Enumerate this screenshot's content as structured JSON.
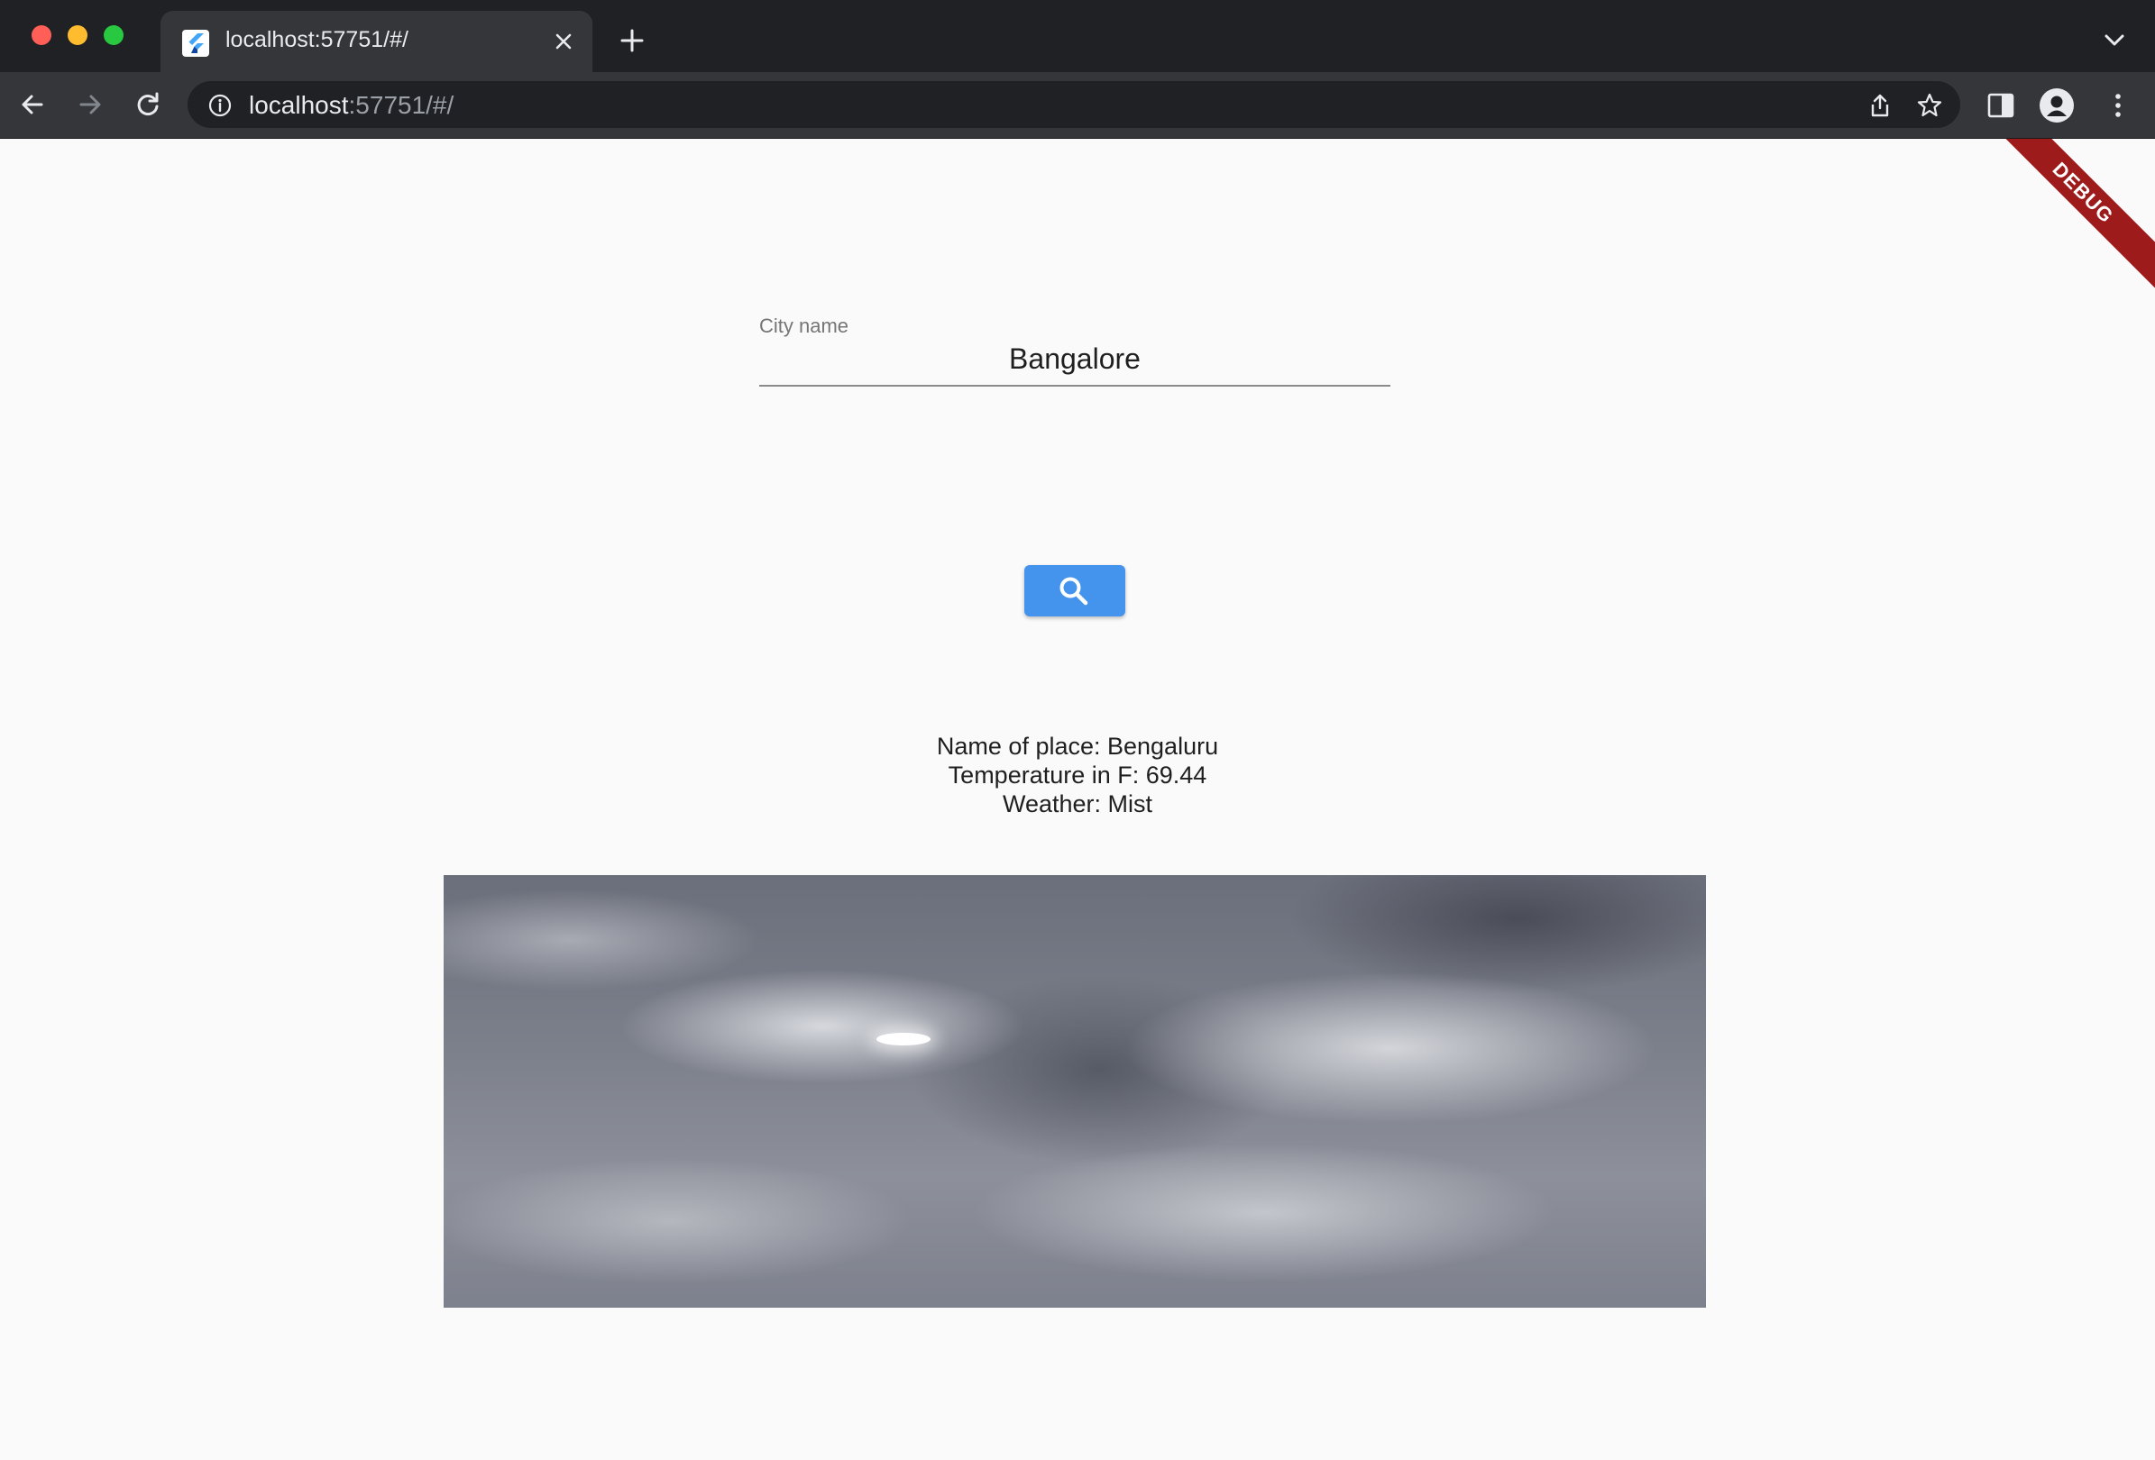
{
  "browser": {
    "tab_title": "localhost:57751/#/",
    "url_host": "localhost",
    "url_rest": ":57751/#/"
  },
  "app": {
    "debug_banner": "DEBUG",
    "city_field": {
      "label": "City name",
      "value": "Bangalore"
    },
    "search_button_icon": "search-icon",
    "result": {
      "place": "Name of place: Bengaluru",
      "temperature": "Temperature in F: 69.44",
      "weather": "Weather: Mist"
    },
    "weather_image": "mist-sky-photo"
  },
  "colors": {
    "accent": "#4493ec",
    "debug": "#9e1b1b"
  }
}
